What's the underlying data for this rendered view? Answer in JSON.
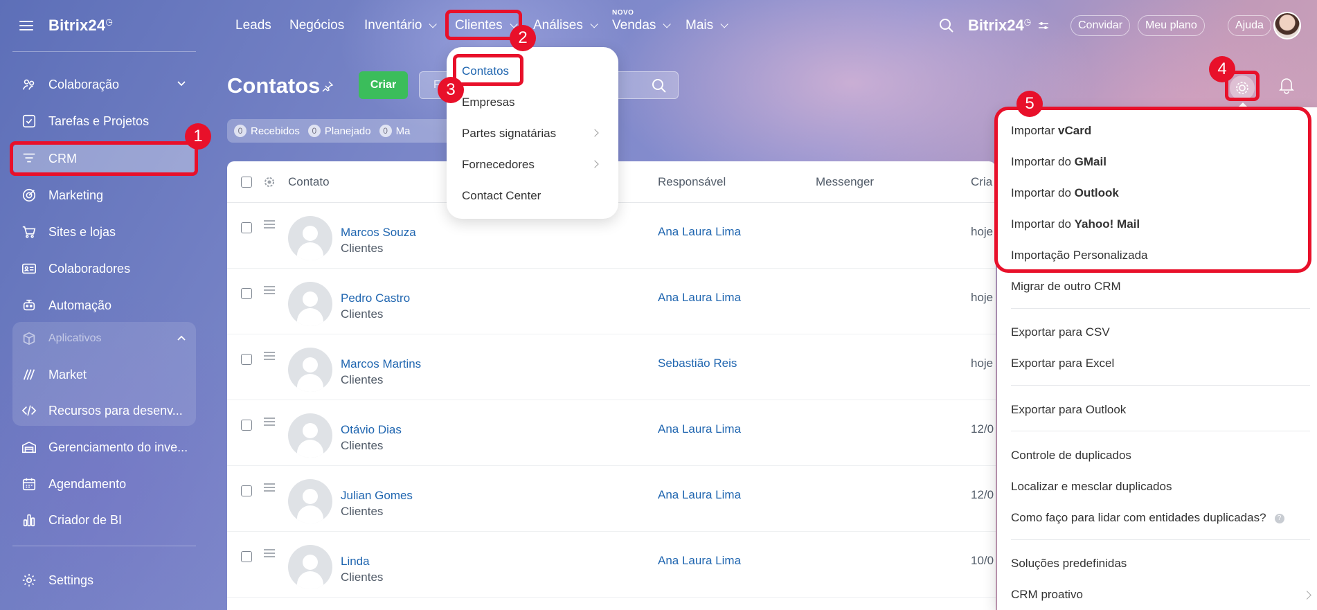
{
  "app": {
    "logo": "Bitrix24",
    "logo_mark": "◷"
  },
  "sidebar": {
    "items": [
      {
        "label": "Colaboração"
      },
      {
        "label": "Tarefas e Projetos"
      },
      {
        "label": "CRM"
      },
      {
        "label": "Marketing"
      },
      {
        "label": "Sites e lojas"
      },
      {
        "label": "Colaboradores"
      },
      {
        "label": "Automação"
      },
      {
        "label": "Aplicativos"
      },
      {
        "label": "Market"
      },
      {
        "label": "Recursos para desenv..."
      },
      {
        "label": "Gerenciamento do inve..."
      },
      {
        "label": "Agendamento"
      },
      {
        "label": "Criador de BI"
      },
      {
        "label": "Settings"
      }
    ]
  },
  "topnav": {
    "items": [
      "Leads",
      "Negócios",
      "Inventário",
      "Clientes",
      "Análises",
      "Vendas",
      "Mais"
    ],
    "new_badge": "NOVO",
    "logo": "Bitrix24",
    "invite": "Convidar",
    "plan": "Meu plano",
    "help": "Ajuda"
  },
  "page": {
    "title": "Contatos",
    "create": "Criar",
    "search_placeholder": "F"
  },
  "counters": [
    {
      "num": "0",
      "label": "Recebidos"
    },
    {
      "num": "0",
      "label": "Planejado"
    },
    {
      "num": "0",
      "label": "Ma"
    }
  ],
  "table": {
    "headers": {
      "contact": "Contato",
      "responsible": "Responsável",
      "messenger": "Messenger",
      "created": "Cria"
    },
    "rows": [
      {
        "name": "Marcos Souza",
        "type": "Clientes",
        "responsible": "Ana Laura Lima",
        "date": "hoje"
      },
      {
        "name": "Pedro Castro",
        "type": "Clientes",
        "responsible": "Ana Laura Lima",
        "date": "hoje"
      },
      {
        "name": "Marcos Martins",
        "type": "Clientes",
        "responsible": "Sebastião Reis",
        "date": "hoje"
      },
      {
        "name": "Otávio Dias",
        "type": "Clientes",
        "responsible": "Ana Laura Lima",
        "date": "12/0"
      },
      {
        "name": "Julian Gomes",
        "type": "Clientes",
        "responsible": "Ana Laura Lima",
        "date": "12/0"
      },
      {
        "name": "Linda",
        "type": "Clientes",
        "responsible": "Ana Laura Lima",
        "date": "10/0"
      }
    ]
  },
  "clients_menu": [
    "Contatos",
    "Empresas",
    "Partes signatárias",
    "Fornecedores",
    "Contact Center"
  ],
  "settings_menu": {
    "import_vcard_pre": "Importar ",
    "import_vcard_b": "vCard",
    "import_gmail_pre": "Importar do ",
    "import_gmail_b": "GMail",
    "import_outlook_pre": "Importar do ",
    "import_outlook_b": "Outlook",
    "import_yahoo_pre": "Importar do ",
    "import_yahoo_b": "Yahoo! Mail",
    "custom_import": "Importação Personalizada",
    "migrate": "Migrar de outro CRM",
    "export_csv": "Exportar para CSV",
    "export_excel": "Exportar para Excel",
    "export_outlook": "Exportar para Outlook",
    "dup_control": "Controle de duplicados",
    "dup_merge": "Localizar e mesclar duplicados",
    "dup_help": "Como faço para lidar com entidades duplicadas?",
    "presets": "Soluções predefinidas",
    "proactive": "CRM proativo"
  },
  "annotations": [
    "1",
    "2",
    "3",
    "4",
    "5"
  ],
  "colors": {
    "highlight": "#e8102a",
    "link": "#2066b0",
    "create_button": "#3bbd5b"
  }
}
